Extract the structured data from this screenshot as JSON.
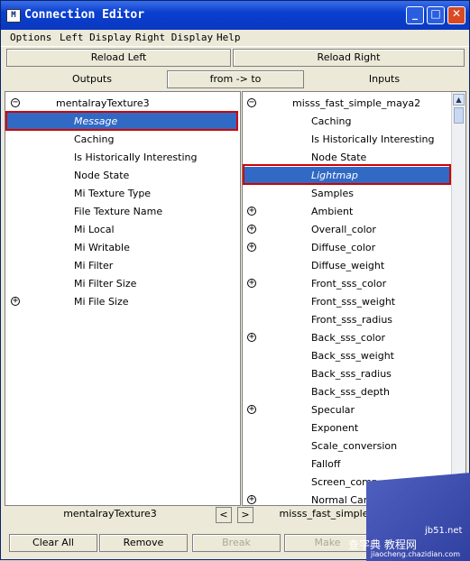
{
  "window": {
    "title": "Connection Editor"
  },
  "title_buttons": {
    "minimize": "_",
    "maximize": "□",
    "close": "✕"
  },
  "menu": [
    "Options",
    "Left Display",
    "Right Display",
    "Help"
  ],
  "reload": {
    "left": "Reload Left",
    "right": "Reload Right"
  },
  "headers": {
    "outputs": "Outputs",
    "direction": "from -> to",
    "inputs": "Inputs"
  },
  "left_panel": {
    "node": "mentalrayTexture3",
    "items": [
      "Message",
      "Caching",
      "Is Historically Interesting",
      "Node State",
      "Mi Texture Type",
      "File Texture Name",
      "Mi Local",
      "Mi Writable",
      "Mi Filter",
      "Mi Filter Size",
      "Mi File Size"
    ]
  },
  "right_panel": {
    "node": "misss_fast_simple_maya2",
    "items": [
      "Caching",
      "Is Historically Interesting",
      "Node State",
      "Lightmap",
      "Samples",
      "Ambient",
      "Overall_color",
      "Diffuse_color",
      "Diffuse_weight",
      "Front_sss_color",
      "Front_sss_weight",
      "Front_sss_radius",
      "Back_sss_color",
      "Back_sss_weight",
      "Back_sss_radius",
      "Back_sss_depth",
      "Specular",
      "Exponent",
      "Scale_conversion",
      "Falloff",
      "Screen_comp",
      "Normal Came"
    ]
  },
  "footer": {
    "left_node": "mentalrayTexture3",
    "right_node": "misss_fast_simple",
    "prev": "<",
    "next": ">"
  },
  "buttons": {
    "clear_all": "Clear All",
    "remove": "Remove",
    "break": "Break",
    "make": "Make"
  },
  "watermark": {
    "line1": "查字典 教程网",
    "line2": "jiaocheng.chazidian.com",
    "site": "jb51.net"
  }
}
